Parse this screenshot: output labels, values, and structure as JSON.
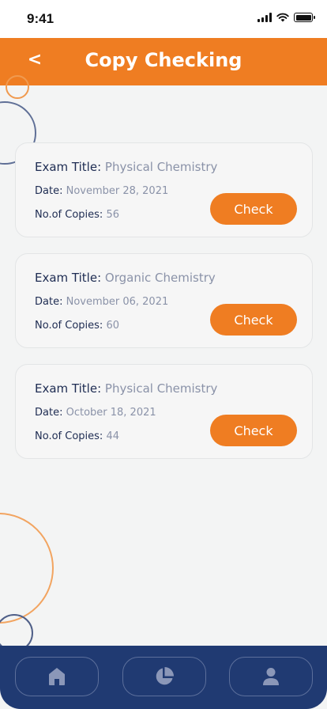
{
  "status_bar": {
    "time": "9:41"
  },
  "header": {
    "back_icon": "chevron-left-icon",
    "back_glyph": "<",
    "title": "Copy Checking"
  },
  "labels": {
    "exam_title": "Exam Title: ",
    "date": "Date: ",
    "copies": "No.of Copies: ",
    "check": "Check"
  },
  "exams": [
    {
      "title": "Physical Chemistry",
      "date": "November 28, 2021",
      "copies": "56"
    },
    {
      "title": "Organic Chemistry",
      "date": "November 06, 2021",
      "copies": "60"
    },
    {
      "title": "Physical Chemistry",
      "date": "October 18, 2021",
      "copies": "44"
    }
  ],
  "nav": {
    "items": [
      "home-icon",
      "pie-chart-icon",
      "user-icon"
    ]
  },
  "colors": {
    "accent": "#ef7d22",
    "nav_bg": "#203a72",
    "label": "#1e2c52",
    "value": "#8a92a8"
  }
}
